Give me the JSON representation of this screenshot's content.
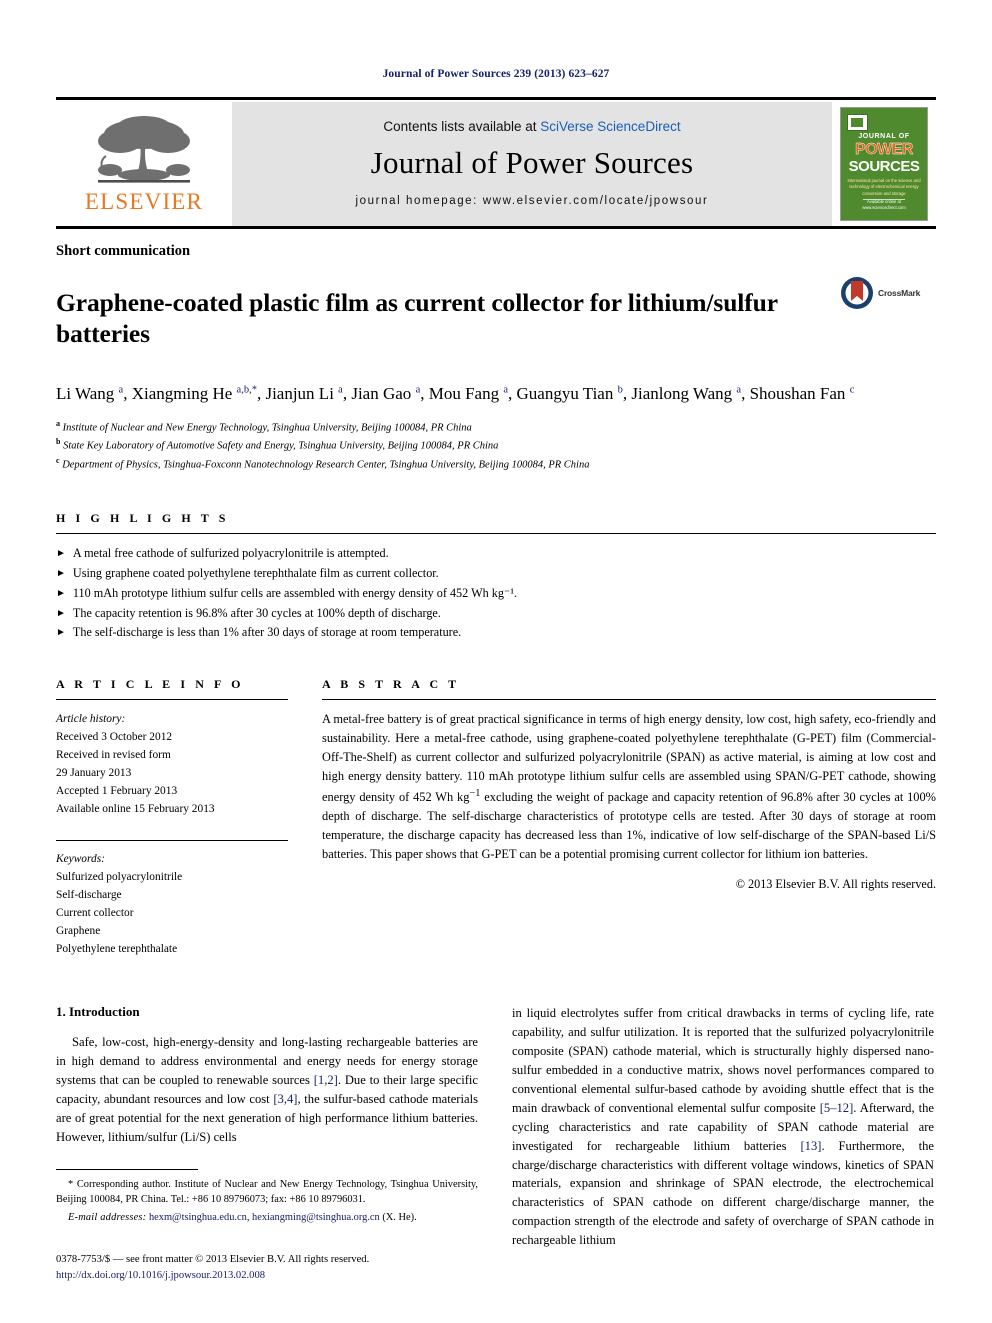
{
  "running_head": "Journal of Power Sources 239 (2013) 623–627",
  "masthead": {
    "publisher_name": "ELSEVIER",
    "contents_prefix": "Contents lists available at ",
    "contents_link": "SciVerse ScienceDirect",
    "journal_title": "Journal of Power Sources",
    "homepage": "journal homepage: www.elsevier.com/locate/jpowsour",
    "cover": {
      "line1": "JOURNAL OF",
      "word_power": "POWER",
      "word_sources": "SOURCES",
      "subtitle": "International journal on the science and technology of electrochemical energy conversion and storage",
      "footer": "Available online at www.sciencedirect.com"
    }
  },
  "article": {
    "type": "Short communication",
    "title": "Graphene-coated plastic film as current collector for lithium/sulfur batteries",
    "crossmark_label": "CrossMark",
    "authors_html": "Li Wang <sup>a</sup>, Xiangming He <sup>a,b,</sup><sup>*</sup>, Jianjun Li <sup>a</sup>, Jian Gao <sup>a</sup>, Mou Fang <sup>a</sup>, Guangyu Tian <sup>b</sup>, Jianlong Wang <sup>a</sup>, Shoushan Fan <sup>c</sup>",
    "affiliations": [
      {
        "marker": "a",
        "text": "Institute of Nuclear and New Energy Technology, Tsinghua University, Beijing 100084, PR China"
      },
      {
        "marker": "b",
        "text": "State Key Laboratory of Automotive Safety and Energy, Tsinghua University, Beijing 100084, PR China"
      },
      {
        "marker": "c",
        "text": "Department of Physics, Tsinghua-Foxconn Nanotechnology Research Center, Tsinghua University, Beijing 100084, PR China"
      }
    ]
  },
  "highlights": {
    "label": "H I G H L I G H T S",
    "bullet": "►",
    "items": [
      "A metal free cathode of sulfurized polyacrylonitrile is attempted.",
      "Using graphene coated polyethylene terephthalate film as current collector.",
      "110 mAh prototype lithium sulfur cells are assembled with energy density of 452 Wh kg⁻¹.",
      "The capacity retention is 96.8% after 30 cycles at 100% depth of discharge.",
      "The self-discharge is less than 1% after 30 days of storage at room temperature."
    ]
  },
  "article_info": {
    "label": "A R T I C L E  I N F O",
    "history_heading": "Article history:",
    "history": [
      "Received 3 October 2012",
      "Received in revised form",
      "29 January 2013",
      "Accepted 1 February 2013",
      "Available online 15 February 2013"
    ],
    "keywords_heading": "Keywords:",
    "keywords": [
      "Sulfurized polyacrylonitrile",
      "Self-discharge",
      "Current collector",
      "Graphene",
      "Polyethylene terephthalate"
    ]
  },
  "abstract": {
    "label": "A B S T R A C T",
    "text_html": "A metal-free battery is of great practical significance in terms of high energy density, low cost, high safety, eco-friendly and sustainability. Here a metal-free cathode, using graphene-coated polyethylene terephthalate (G-PET) film (Commercial-Off-The-Shelf) as current collector and sulfurized polyacrylonitrile (SPAN) as active material, is aiming at low cost and high energy density battery. 110 mAh prototype lithium sulfur cells are assembled using SPAN/G-PET cathode, showing energy density of 452 Wh kg<sup>−1</sup> excluding the weight of package and capacity retention of 96.8% after 30 cycles at 100% depth of discharge. The self-discharge characteristics of prototype cells are tested. After 30 days of storage at room temperature, the discharge capacity has decreased less than 1%, indicative of low self-discharge of the SPAN-based Li/S batteries. This paper shows that G-PET can be a potential promising current collector for lithium ion batteries.",
    "copyright": "© 2013 Elsevier B.V. All rights reserved."
  },
  "intro": {
    "heading": "1.  Introduction",
    "left_para_html": "Safe, low-cost, high-energy-density and long-lasting rechargeable batteries are in high demand to address environmental and energy needs for energy storage systems that can be coupled to renewable sources <a class=\"cite\" href=\"#\">[1,2]</a>. Due to their large specific capacity, abundant resources and low cost <a class=\"cite\" href=\"#\">[3,4]</a>, the sulfur-based cathode materials are of great potential for the next generation of high performance lithium batteries. However, lithium/sulfur (Li/S) cells",
    "right_para_html": "in liquid electrolytes suffer from critical drawbacks in terms of cycling life, rate capability, and sulfur utilization. It is reported that the sulfurized polyacrylonitrile composite (SPAN) cathode material, which is structurally highly dispersed nano-sulfur embedded in a conductive matrix, shows novel performances compared to conventional elemental sulfur-based cathode by avoiding shuttle effect that is the main drawback of conventional elemental sulfur composite <a class=\"cite\" href=\"#\">[5–12]</a>. Afterward, the cycling characteristics and rate capability of SPAN cathode material are investigated for rechargeable lithium batteries <a class=\"cite\" href=\"#\">[13]</a>. Furthermore, the charge/discharge characteristics with different voltage windows, kinetics of SPAN materials, expansion and shrinkage of SPAN electrode, the electrochemical characteristics of SPAN cathode on different charge/discharge manner, the compaction strength of the electrode and safety of overcharge of SPAN cathode in rechargeable lithium"
  },
  "footnotes": {
    "corresponding_html": "* Corresponding author. Institute of Nuclear and New Energy Technology, Tsinghua University, Beijing 100084, PR China. Tel.: +86 10 89796073; fax: +86 10 89796031.",
    "email_label": "E-mail addresses:",
    "email1": "hexm@tsinghua.edu.cn",
    "email2": "hexiangming@tsinghua.org.cn",
    "email_suffix": "(X. He).",
    "issn_line": "0378-7753/$ — see front matter © 2013 Elsevier B.V. All rights reserved.",
    "doi": "http://dx.doi.org/10.1016/j.jpowsour.2013.02.008"
  }
}
